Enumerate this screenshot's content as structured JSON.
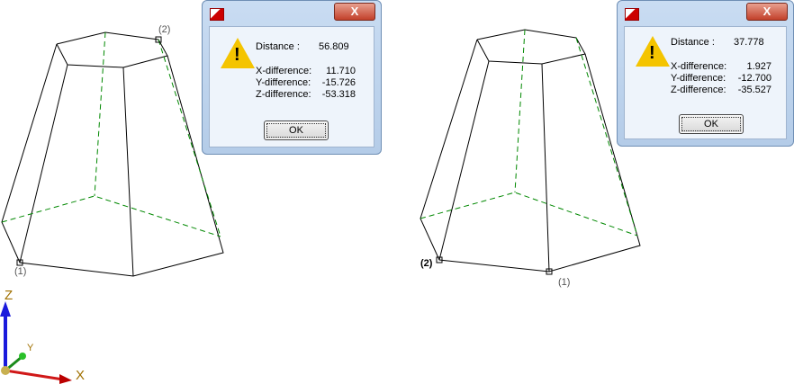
{
  "viewport_left": {
    "point_labels": [
      "(1)",
      "(2)"
    ]
  },
  "viewport_right": {
    "point_labels": [
      "(1)",
      "(2)"
    ]
  },
  "axes": {
    "x": "X",
    "y": "Y",
    "z": "Z"
  },
  "dialog_left": {
    "distance_label": "Distance :",
    "distance": "56.809",
    "x_label": "X-difference:",
    "x": "11.710",
    "y_label": "Y-difference:",
    "y": "-15.726",
    "z_label": "Z-difference:",
    "z": "-53.318",
    "ok": "OK",
    "close": "X"
  },
  "dialog_right": {
    "distance_label": "Distance :",
    "distance": "37.778",
    "x_label": "X-difference:",
    "x": "1.927",
    "y_label": "Y-difference:",
    "y": "-12.700",
    "z_label": "Z-difference:",
    "z": "-35.527",
    "ok": "OK",
    "close": "X"
  }
}
